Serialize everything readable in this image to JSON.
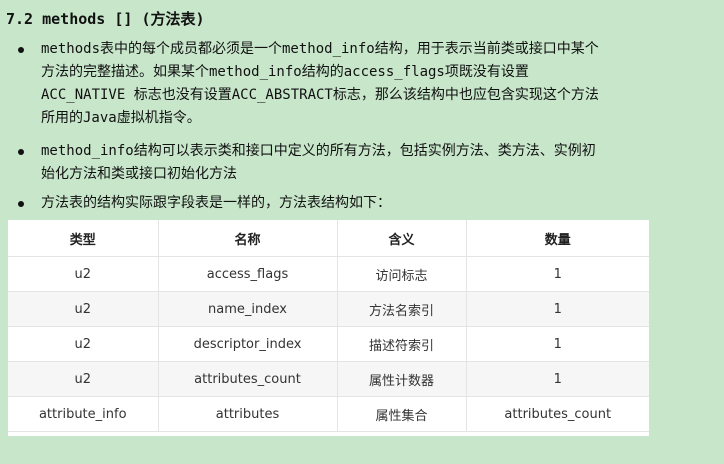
{
  "heading": "7.2 methods [] (方法表)",
  "bullets": [
    {
      "lines": [
        "methods表中的每个成员都必须是一个method_info结构，用于表示当前类或接口中某个",
        "方法的完整描述。如果某个method_info结构的access_flags项既没有设置",
        "ACC_NATIVE 标志也没有设置ACC_ABSTRACT标志，那么该结构中也应包含实现这个方法",
        "所用的Java虚拟机指令。"
      ]
    },
    {
      "lines": [
        "method_info结构可以表示类和接口中定义的所有方法，包括实例方法、类方法、实例初",
        "始化方法和类或接口初始化方法"
      ]
    },
    {
      "lines": [
        "方法表的结构实际跟字段表是一样的，方法表结构如下："
      ]
    }
  ],
  "table": {
    "headers": [
      "类型",
      "名称",
      "含义",
      "数量"
    ],
    "rows": [
      [
        "u2",
        "access_flags",
        "访问标志",
        "1"
      ],
      [
        "u2",
        "name_index",
        "方法名索引",
        "1"
      ],
      [
        "u2",
        "descriptor_index",
        "描述符索引",
        "1"
      ],
      [
        "u2",
        "attributes_count",
        "属性计数器",
        "1"
      ],
      [
        "attribute_info",
        "attributes",
        "属性集合",
        "attributes_count"
      ]
    ]
  },
  "colors": {
    "page_background": "#c7e6ca",
    "table_background": "#ffffff",
    "row_alt_background": "#f6f6f6"
  }
}
